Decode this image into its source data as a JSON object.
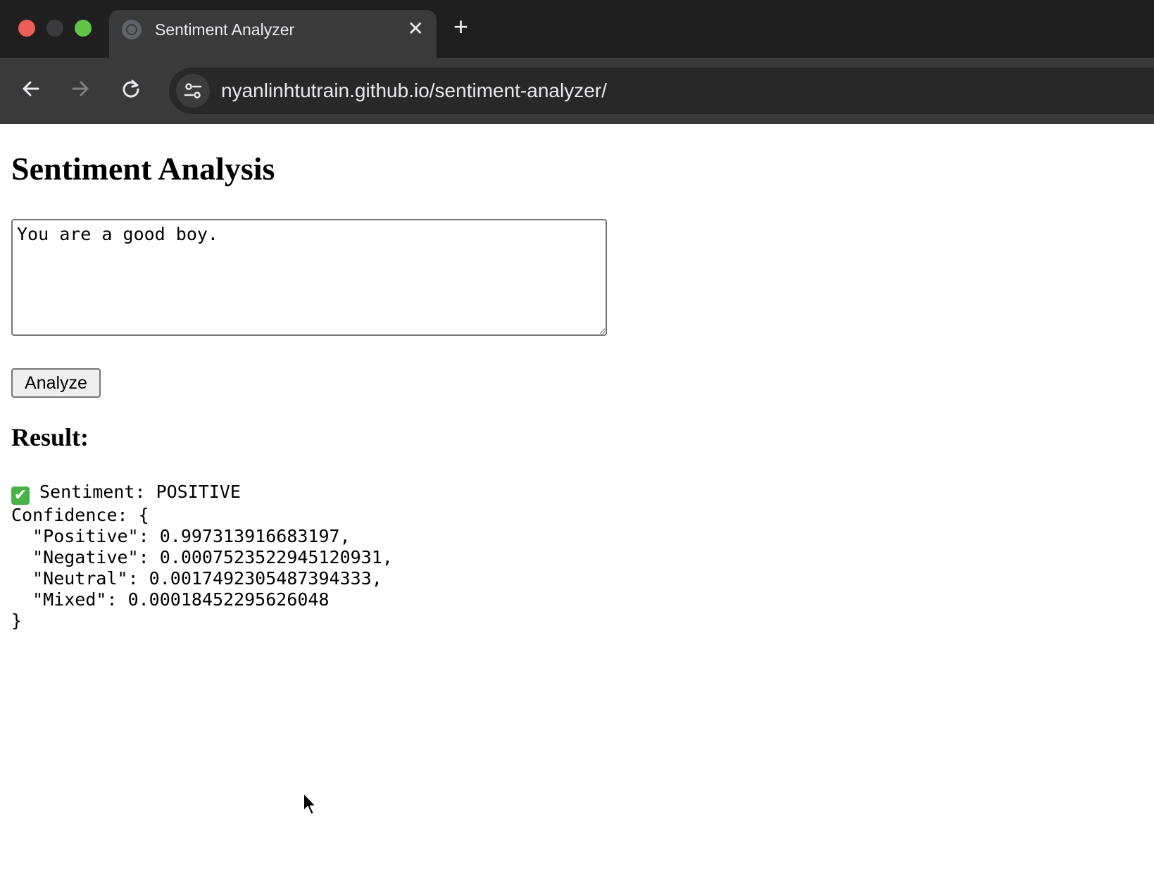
{
  "browser": {
    "tab_title": "Sentiment Analyzer",
    "tab_close": "✕",
    "new_tab": "+",
    "url": "nyanlinhtutrain.github.io/sentiment-analyzer/",
    "back_icon": "arrow-left-icon",
    "forward_icon": "arrow-right-icon",
    "reload_icon": "reload-icon"
  },
  "page": {
    "heading": "Sentiment Analysis",
    "input_text": "You are a good boy.",
    "analyze_label": "Analyze",
    "result_heading": "Result:",
    "result": {
      "sentiment_line": "Sentiment: POSITIVE",
      "confidence_open": "Confidence: {",
      "positive_line": "  \"Positive\": 0.997313916683197,",
      "negative_line": "  \"Negative\": 0.0007523522945120931,",
      "neutral_line": "  \"Neutral\": 0.0017492305487394333,",
      "mixed_line": "  \"Mixed\": 0.00018452295626048",
      "confidence_close": "}"
    }
  },
  "colors": {
    "accent_check": "#47b347",
    "chrome_bg": "#202124",
    "toolbar_bg": "#3a3a3b"
  }
}
